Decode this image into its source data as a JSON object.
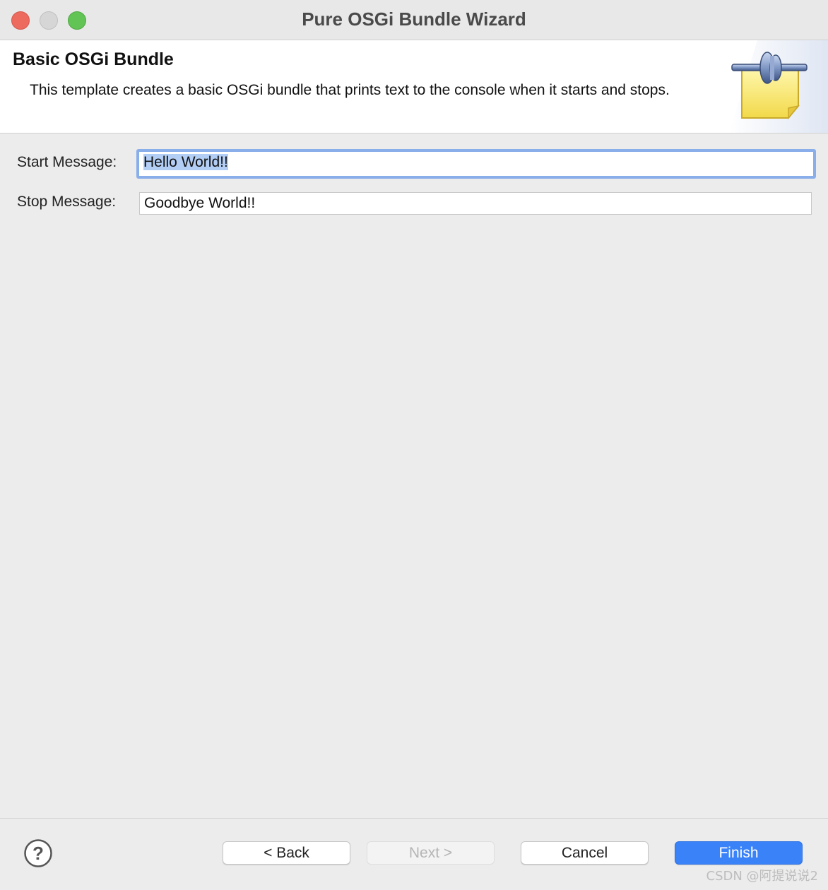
{
  "window": {
    "title": "Pure OSGi Bundle Wizard"
  },
  "header": {
    "title": "Basic OSGi Bundle",
    "description": "This template creates a basic OSGi bundle that prints text to the console when it starts and stops."
  },
  "form": {
    "start_label": "Start Message:",
    "start_value": "Hello World!!",
    "stop_label": "Stop Message:",
    "stop_value": "Goodbye World!!"
  },
  "buttons": {
    "back": "< Back",
    "next": "Next >",
    "cancel": "Cancel",
    "finish": "Finish"
  },
  "icons": {
    "help": "help-icon",
    "banner": "plugin-bundle-icon"
  },
  "colors": {
    "accent": "#3a82f7",
    "focus_ring": "#8aaeea",
    "selection": "#b3cef5"
  },
  "watermark": "CSDN @阿提说说2"
}
